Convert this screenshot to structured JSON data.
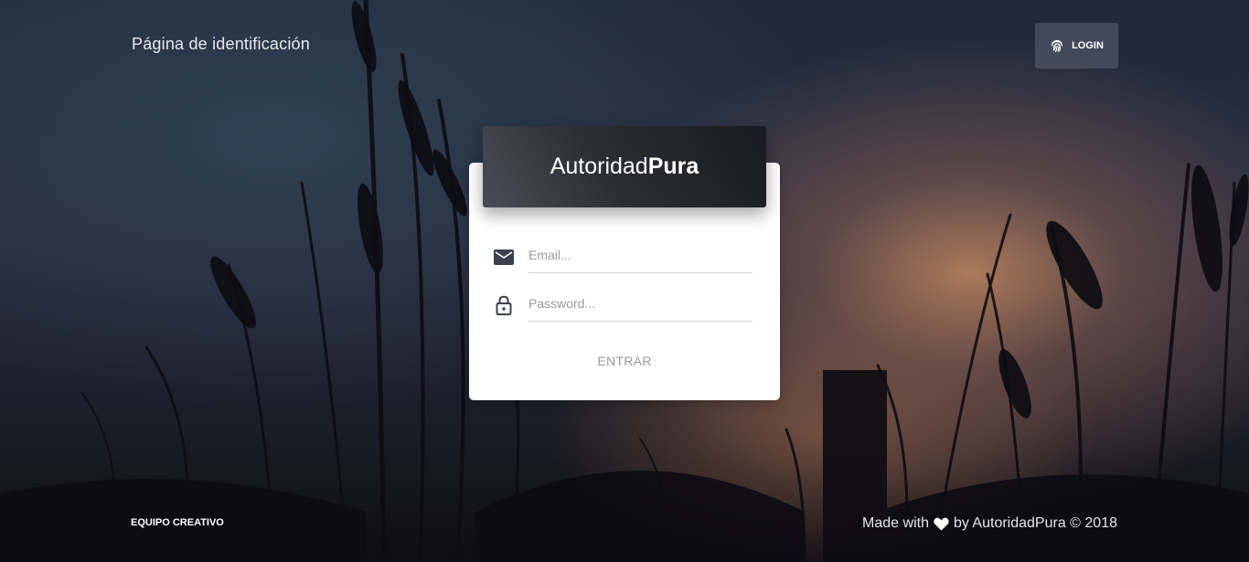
{
  "header": {
    "title": "Página de identificación",
    "login_label": "LOGIN",
    "login_icon": "fingerprint-icon"
  },
  "card": {
    "brand_light": "Autoridad",
    "brand_bold": "Pura",
    "email_placeholder": "Email...",
    "email_icon": "mail-icon",
    "password_placeholder": "Password...",
    "password_icon": "lock-icon",
    "submit_label": "ENTRAR"
  },
  "footer": {
    "left_link": "EQUIPO CREATIVO",
    "made_with": "Made with",
    "heart_icon": "heart-icon",
    "credit": "by AutoridadPura © 2018"
  },
  "colors": {
    "header_gradient_start": "#4b4d56",
    "header_gradient_end": "#1a1b20",
    "card_bg": "#ffffff",
    "button_bg": "#4e5464"
  }
}
